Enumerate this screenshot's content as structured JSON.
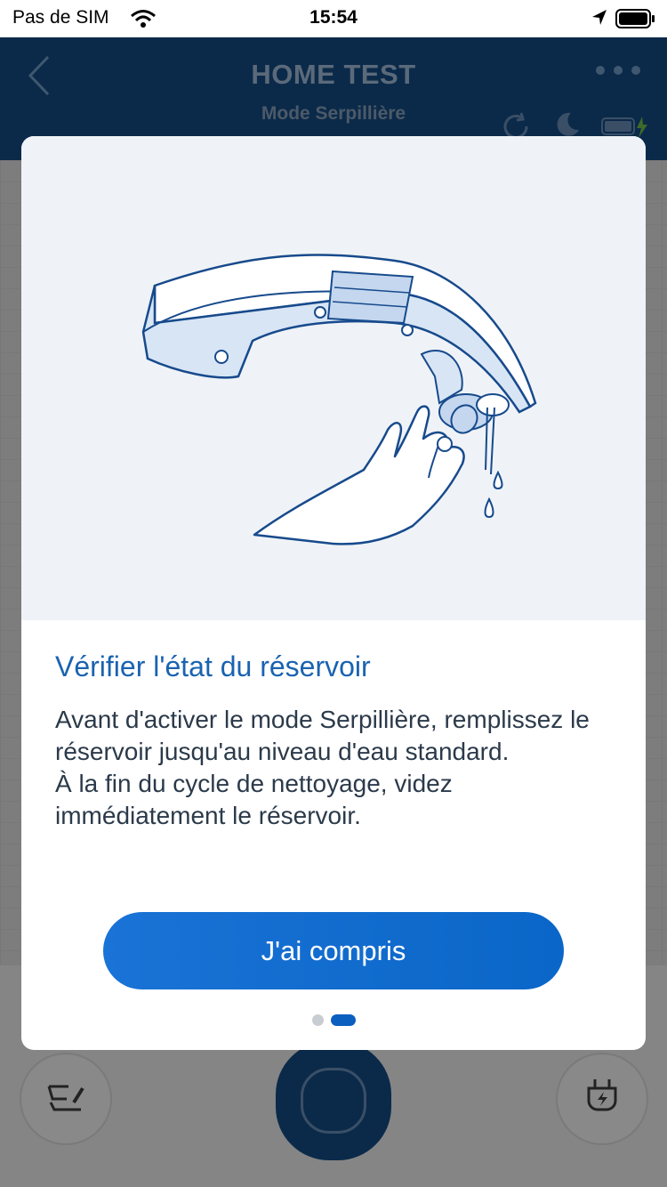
{
  "status_bar": {
    "carrier": "Pas de SIM",
    "time": "15:54"
  },
  "header": {
    "title": "HOME TEST",
    "subtitle": "Mode Serpillière"
  },
  "modal": {
    "title": "Vérifier l'état du réservoir",
    "body_lines": [
      "Avant d'activer le mode Serpillière, remplissez le réservoir jusqu'au niveau d'eau standard.",
      "À la fin du cycle de nettoyage, videz immédiatement le réservoir."
    ],
    "button_label": "J'ai compris",
    "pager": {
      "pages": 2,
      "current": 2
    }
  },
  "colors": {
    "accent": "#1a63b0",
    "button": "#1a73d6",
    "header_bg": "#0b2a4a",
    "illustration_bg": "#eff3f7"
  },
  "icons": {
    "back": "chevron-left-icon",
    "more": "more-horizontal-icon",
    "refresh": "refresh-icon",
    "moon": "moon-icon",
    "battery": "battery-charging-icon",
    "edit": "edit-map-icon",
    "dock": "dock-plug-icon",
    "start": "start-cleaning-icon"
  }
}
